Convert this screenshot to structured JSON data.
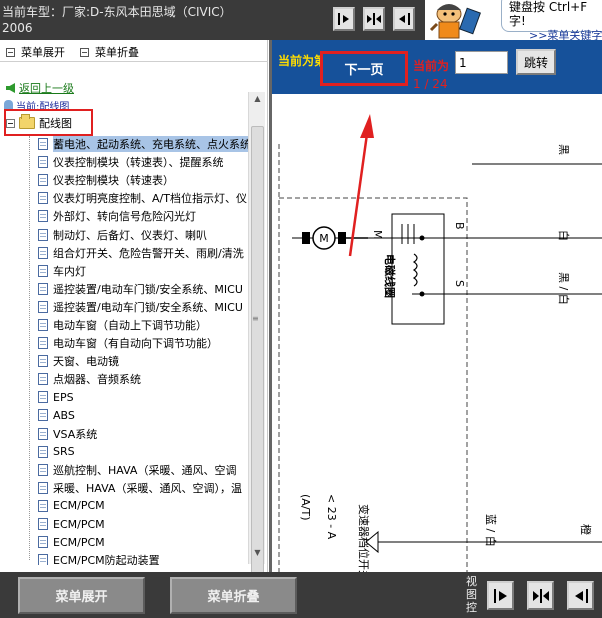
{
  "header": {
    "title_line1": "当前车型：厂家:D-东风本田思域（CIVIC）",
    "title_line2": "2006",
    "tip_line1": "键盘按    Ctrl+F",
    "tip_line2": "字!",
    "keyword_link": ">>菜单关键字",
    "view_buttons": [
      "align-left-icon",
      "fit-width-icon",
      "align-right-icon"
    ]
  },
  "left": {
    "toolbar": {
      "expand": "菜单展开",
      "collapse": "菜单折叠"
    },
    "back_link": "返回上一级",
    "current": "当前:配线图",
    "root_folder": "配线图",
    "items": [
      "蓄电池、起动系统、充电系统、点火系统",
      "仪表控制模块（转速表）、提醒系统",
      "仪表控制模块（转速表）",
      "仪表灯明亮度控制、A/T档位指示灯、仪",
      "外部灯、转向信号危险闪光灯",
      "制动灯、后备灯、仪表灯、喇叭",
      "组合灯开关、危险告警开关、雨刷/清洗",
      "车内灯",
      "遥控装置/电动车门锁/安全系统、MICU",
      "遥控装置/电动车门锁/安全系统、MICU",
      "电动车窗（自动上下调节功能）",
      "电动车窗（有自动向下调节功能）",
      "天窗、电动镜",
      "点烟器、音频系统",
      "EPS",
      "ABS",
      "VSA系统",
      "SRS",
      "巡航控制、HAVA（采暖、通风、空调",
      "采暖、HAVA（采暖、通风、空调），温",
      "ECM/PCM",
      "ECM/PCM",
      "ECM/PCM",
      "ECM/PCM防起动装置"
    ]
  },
  "viewer": {
    "current_page_label": "当前为第一页",
    "next_button": "下一页",
    "current_label": "当前为",
    "page_count": "1 / 24",
    "page_input_value": "1",
    "jump_button": "跳转",
    "diagram": {
      "wire_labels": [
        "B",
        "S"
      ],
      "wire_colors": [
        "黑",
        "白",
        "黑 / 白",
        "蓝 / 白",
        "橙"
      ],
      "component_label": "电磁线圈",
      "motor_label": "M",
      "switch_label": "变速器档位开关",
      "switch_code": "< 23 - A",
      "switch_note": "(A/T)"
    }
  },
  "bottom": {
    "expand_button": "菜单展开",
    "collapse_button": "菜单折叠",
    "view_label": "视图控",
    "view_buttons": [
      "align-left-icon",
      "fit-width-icon",
      "align-right-icon"
    ]
  },
  "colors": {
    "header_bg": "#3a3a3a",
    "nav_blue": "#16519a",
    "highlight_red": "#e02020",
    "selection_blue": "#a8c4e6"
  }
}
